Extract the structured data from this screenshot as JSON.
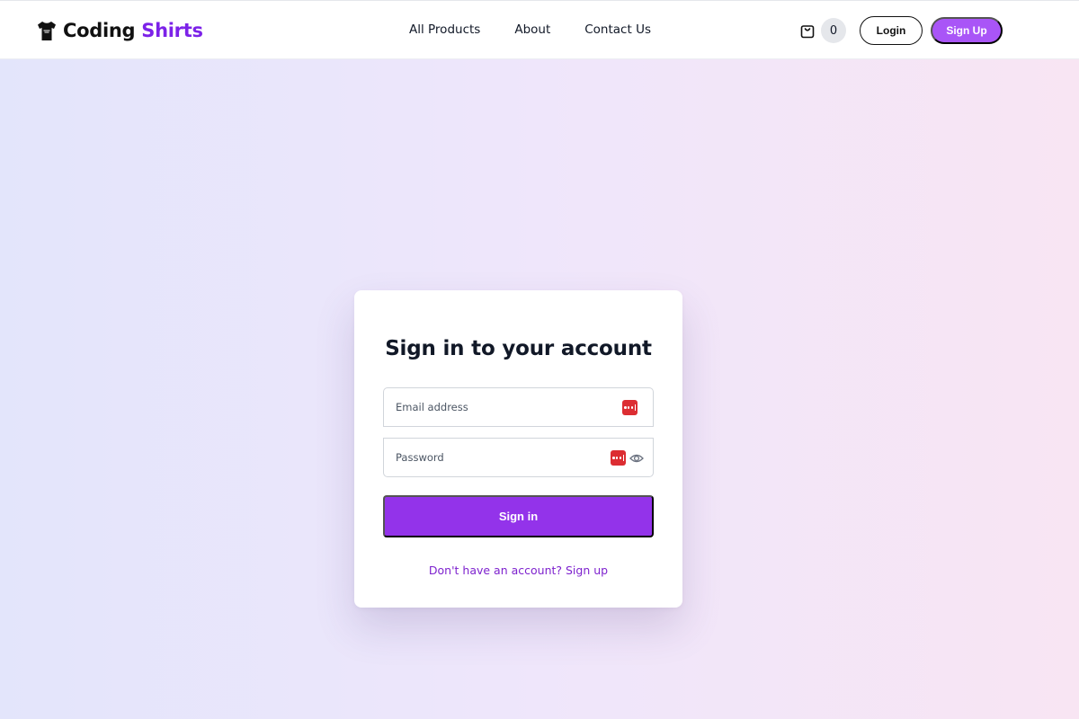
{
  "header": {
    "brand": {
      "part1": "Coding",
      "part2": "Shirts",
      "logo_icon": "tshirt-icon",
      "part2_color": "#7c22e8"
    },
    "nav_links": [
      "All Products",
      "About",
      "Contact Us"
    ],
    "cart": {
      "icon": "shopping-bag-icon",
      "count": "0"
    },
    "login_label": "Login",
    "signup_label": "Sign Up",
    "accent_color": "#a955f7"
  },
  "signin_card": {
    "title": "Sign in to your account",
    "email_placeholder": "Email address",
    "password_placeholder": "Password",
    "password_manager_icon": "password-manager-icon",
    "show_password_icon": "eye-icon",
    "submit_label": "Sign in",
    "signup_link": "Don't have an account? Sign up",
    "button_color": "#9333ea",
    "link_color": "#7e22ce"
  }
}
